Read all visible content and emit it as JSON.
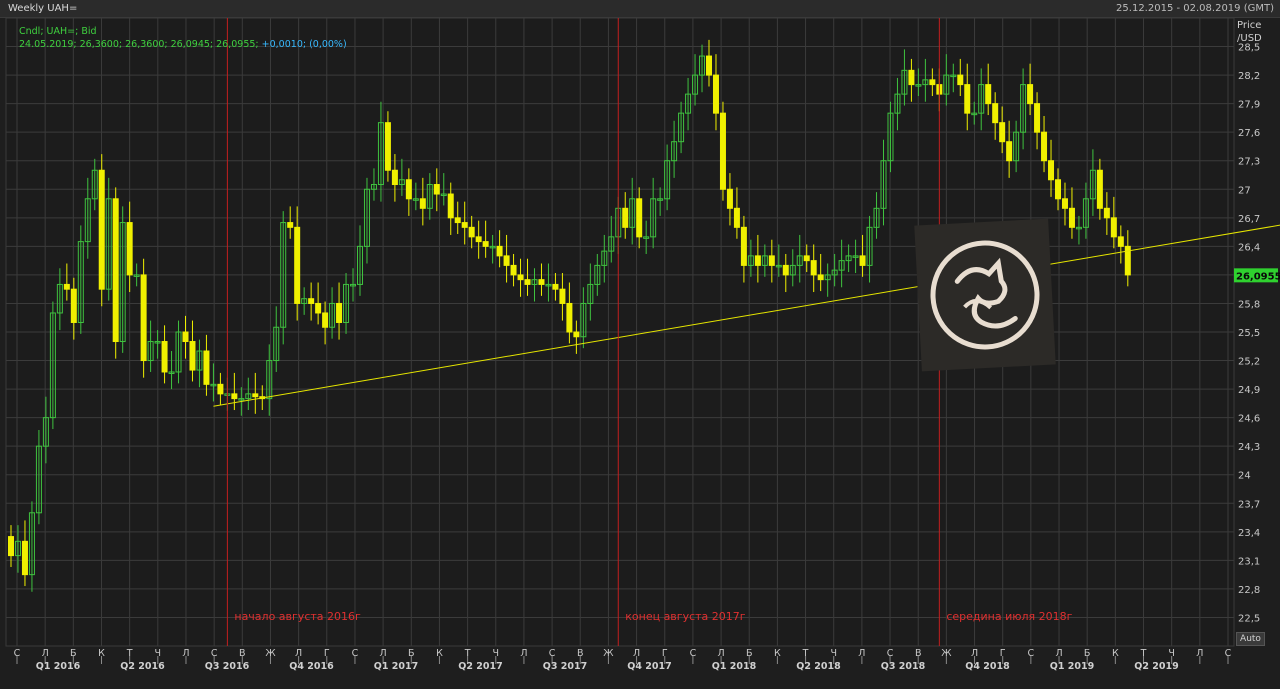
{
  "window": {
    "title": "Weekly UAH=",
    "date_range": "25.12.2015 - 02.08.2019 (GMT)"
  },
  "legend": {
    "line1": "Cndl; UAH=; Bid",
    "line2_values": "24.05.2019; 26,3600; 26,3600; 26,0945; 26,0955;",
    "line2_change": "+0,0010; (0,00%)"
  },
  "axis": {
    "unit_label": "Price\n/USD",
    "auto_label": "Auto",
    "last_price_label": "26,0955"
  },
  "colors": {
    "up": "#3fc23f",
    "down": "#f0f000",
    "grid": "#3b3b3b",
    "marker_line": "#c21f1f",
    "trend_line": "#e6e600",
    "last_price_bg": "#2fd12f"
  },
  "chart_data": {
    "type": "candlestick",
    "title": "Weekly UAH=",
    "ylabel": "Price /USD",
    "ylim": [
      22.2,
      28.8
    ],
    "y_ticks": [
      "22,5",
      "22,8",
      "23,1",
      "23,4",
      "23,7",
      "24",
      "24,3",
      "24,6",
      "24,9",
      "25,2",
      "25,5",
      "25,8",
      "26,1",
      "26,4",
      "26,7",
      "27",
      "27,3",
      "27,6",
      "27,9",
      "28,2",
      "28,5"
    ],
    "x_month_ticks": [
      "С",
      "Л",
      "Б",
      "К",
      "Т",
      "Ч",
      "Л",
      "С",
      "В",
      "Ж",
      "Л",
      "Г",
      "С",
      "Л",
      "Б",
      "К",
      "Т",
      "Ч",
      "Л",
      "С",
      "В",
      "Ж",
      "Л",
      "Г",
      "С",
      "Л",
      "Б",
      "К",
      "Т",
      "Ч",
      "Л",
      "С",
      "В",
      "Ж",
      "Л",
      "Г",
      "С",
      "Л",
      "Б",
      "К",
      "Т",
      "Ч",
      "Л",
      "С"
    ],
    "x_quarter_ticks": [
      "Q1 2016",
      "Q2 2016",
      "Q3 2016",
      "Q4 2016",
      "Q1 2017",
      "Q2 2017",
      "Q3 2017",
      "Q4 2017",
      "Q1 2018",
      "Q2 2018",
      "Q3 2018",
      "Q4 2018",
      "Q1 2019",
      "Q2 2019"
    ],
    "annotations": [
      {
        "text": "начало августа 2016г",
        "week": 31
      },
      {
        "text": "конец августа 2017г",
        "week": 87
      },
      {
        "text": "середина июля 2018г",
        "week": 133
      }
    ],
    "trend_lines": [
      {
        "x": [
          29,
          188
        ],
        "y": [
          24.72,
          26.7
        ]
      }
    ],
    "last_price": 26.0955,
    "week_closes": [
      23.15,
      23.3,
      22.95,
      23.6,
      24.3,
      24.6,
      25.7,
      26.0,
      25.95,
      25.6,
      26.45,
      26.9,
      27.2,
      25.95,
      26.9,
      25.4,
      26.65,
      26.1,
      26.1,
      25.2,
      25.4,
      25.4,
      25.08,
      25.08,
      25.5,
      25.4,
      25.1,
      25.3,
      24.95,
      24.95,
      24.85,
      24.85,
      24.8,
      24.8,
      24.85,
      24.82,
      24.8,
      25.2,
      25.55,
      26.65,
      26.6,
      25.8,
      25.85,
      25.8,
      25.7,
      25.55,
      25.8,
      25.6,
      26.0,
      26.0,
      26.4,
      27.0,
      27.05,
      27.7,
      27.2,
      27.05,
      27.1,
      26.9,
      26.9,
      26.8,
      27.05,
      26.95,
      26.95,
      26.7,
      26.65,
      26.6,
      26.5,
      26.45,
      26.4,
      26.4,
      26.3,
      26.2,
      26.1,
      26.05,
      26.0,
      26.05,
      26.0,
      26.0,
      25.95,
      25.8,
      25.5,
      25.45,
      25.8,
      26.0,
      26.2,
      26.35,
      26.5,
      26.8,
      26.6,
      26.9,
      26.5,
      26.5,
      26.9,
      26.9,
      27.3,
      27.5,
      27.8,
      28.0,
      28.2,
      28.4,
      28.2,
      27.8,
      27.0,
      26.8,
      26.6,
      26.2,
      26.3,
      26.2,
      26.3,
      26.2,
      26.2,
      26.1,
      26.2,
      26.3,
      26.25,
      26.1,
      26.05,
      26.1,
      26.15,
      26.25,
      26.3,
      26.3,
      26.2,
      26.6,
      26.8,
      27.3,
      27.8,
      28.0,
      28.25,
      28.1,
      28.1,
      28.15,
      28.1,
      28.0,
      28.2,
      28.2,
      28.1,
      27.8,
      27.8,
      28.1,
      27.9,
      27.7,
      27.5,
      27.3,
      27.6,
      28.1,
      27.9,
      27.6,
      27.3,
      27.1,
      26.9,
      26.8,
      26.6,
      26.6,
      26.9,
      27.2,
      26.8,
      26.7,
      26.5,
      26.4,
      26.1
    ]
  }
}
